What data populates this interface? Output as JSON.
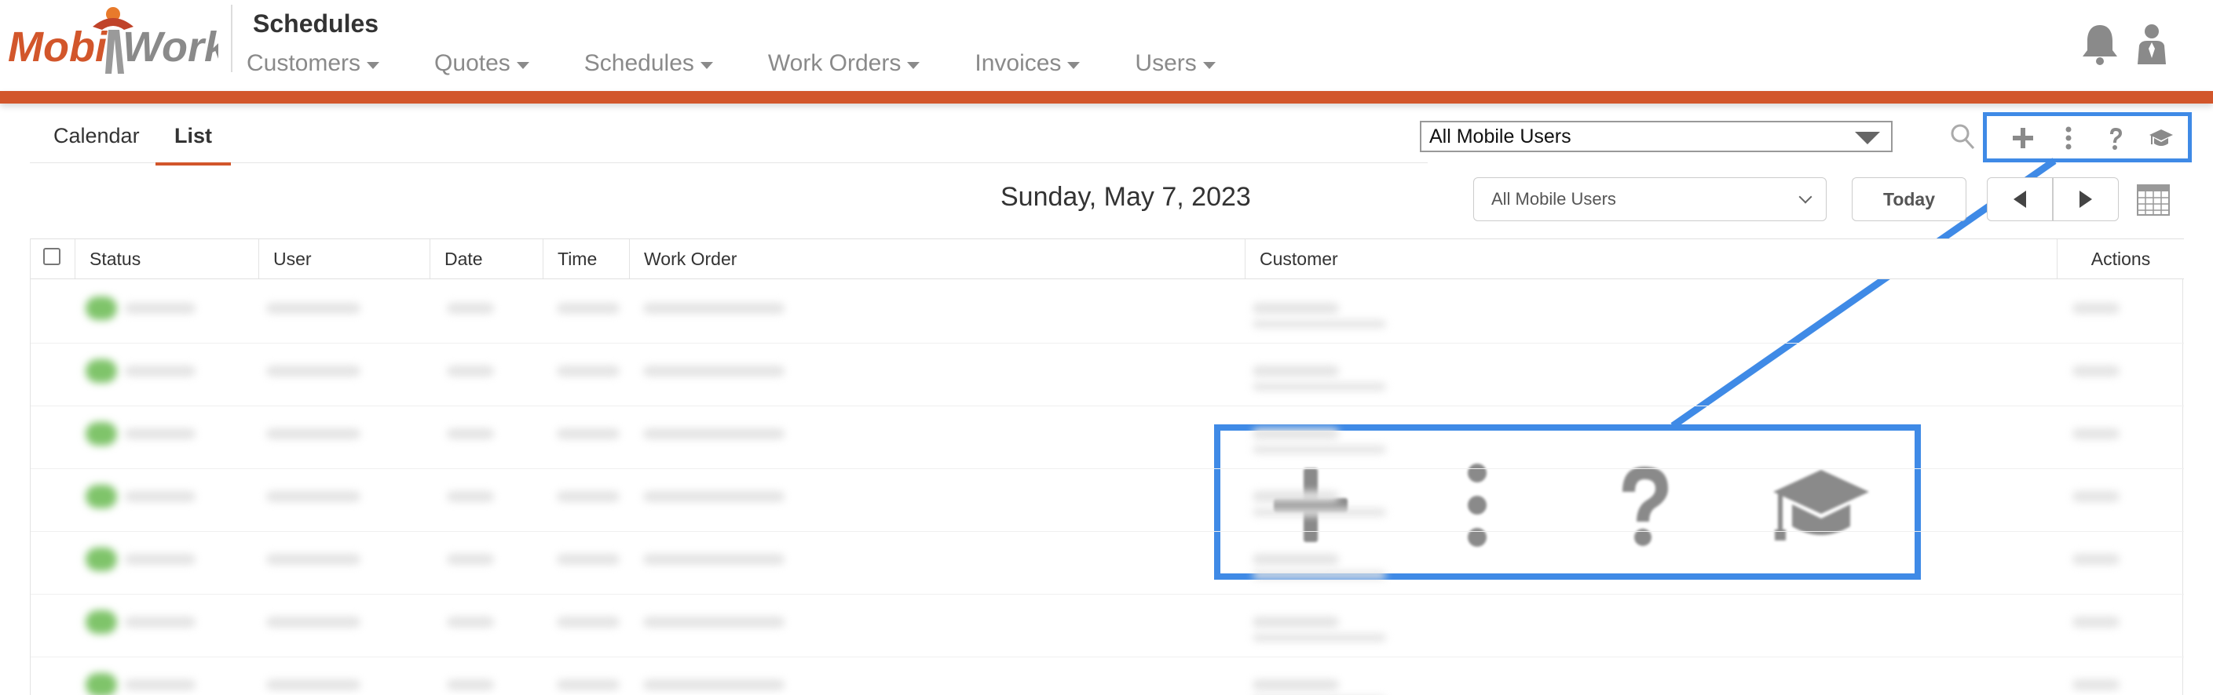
{
  "header": {
    "logo_text_left": "Mobi",
    "logo_text_right": "Work",
    "title": "Schedules",
    "nav": [
      "Customers",
      "Quotes",
      "Schedules",
      "Work Orders",
      "Invoices",
      "Users"
    ]
  },
  "tabs": {
    "calendar": "Calendar",
    "list": "List"
  },
  "mobile_users_select": {
    "selected": "All Mobile Users"
  },
  "date_bar": {
    "date": "Sunday, May 7, 2023",
    "filter_selected": "All Mobile Users",
    "today_label": "Today"
  },
  "table": {
    "columns": [
      "Status",
      "User",
      "Date",
      "Time",
      "Work Order",
      "Customer",
      "Actions"
    ],
    "row_count": 7
  },
  "colors": {
    "brand_orange": "#d2562b",
    "highlight_blue": "#3f8ae6",
    "icon_gray": "#8a8a8a"
  },
  "icons": [
    "bell-icon",
    "user-icon",
    "search-icon",
    "plus-icon",
    "more-vertical-icon",
    "help-icon",
    "graduation-cap-icon",
    "calendar-icon"
  ]
}
